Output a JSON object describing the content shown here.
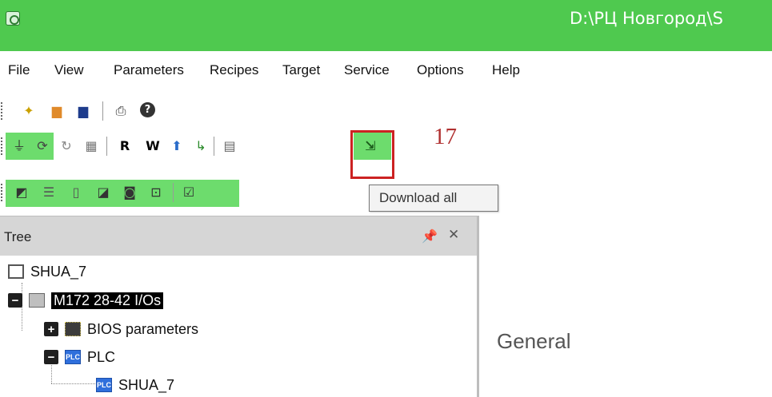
{
  "window": {
    "title": "D:\\РЦ Новгород\\S"
  },
  "menu": [
    "File",
    "View",
    "Parameters",
    "Recipes",
    "Target",
    "Service",
    "Options",
    "Help"
  ],
  "toolbar1": [
    "new-project-icon",
    "open-icon",
    "save-icon",
    "print-icon",
    "help-icon"
  ],
  "toolbar2": [
    "connect-icon",
    "sync-icon",
    "refresh-icon",
    "table-icon",
    "read-label",
    "write-label",
    "upload-icon",
    "download-icon",
    "grid-icon",
    "download-all-icon"
  ],
  "toolbar2_labels": {
    "read": "R",
    "write": "W"
  },
  "toolbar3": [
    "view1-icon",
    "tree-view-icon",
    "panel-icon",
    "chart-icon",
    "monitor-icon",
    "device-icon",
    "window-icon"
  ],
  "annotation": {
    "number": "17",
    "color": "#cc2222"
  },
  "tooltip": {
    "text": "Download all"
  },
  "tree": {
    "title": "Tree",
    "nodes": [
      {
        "label": "SHUA_7"
      },
      {
        "label": "M172 28-42 I/Os"
      },
      {
        "label": "BIOS parameters"
      },
      {
        "label": "PLC"
      },
      {
        "label": "SHUA_7"
      }
    ],
    "icon_text": "PLC"
  },
  "right_pane": {
    "heading": "General"
  },
  "colors": {
    "titlebar": "#4fc94f",
    "toolbar_highlight": "#6ddc6d",
    "plc_icon": "#2f6fdc"
  }
}
